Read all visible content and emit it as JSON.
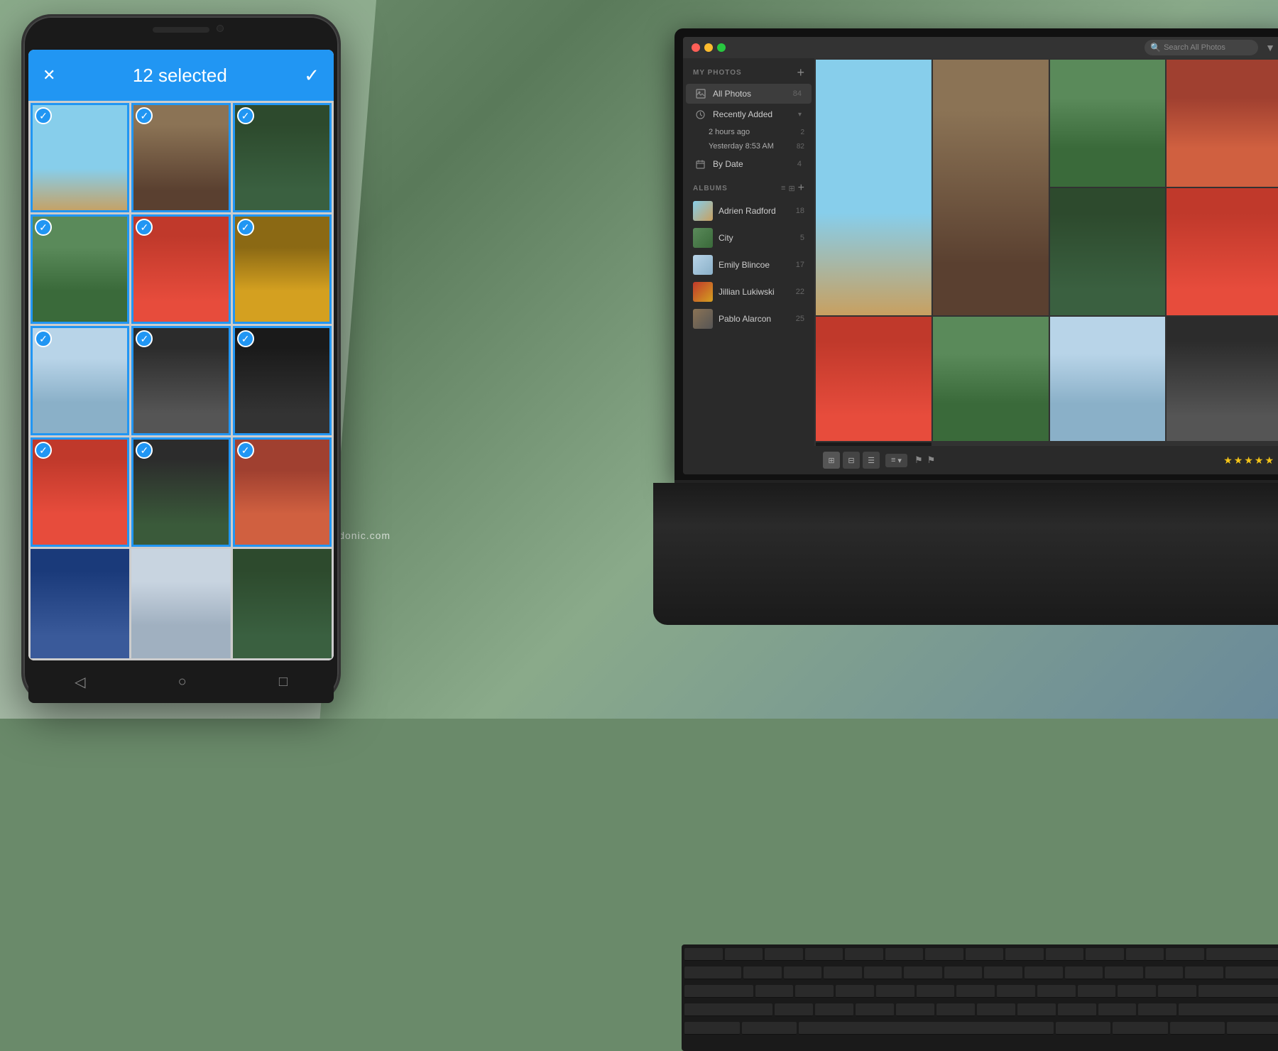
{
  "background": {
    "color": "#6a8a6a"
  },
  "phone": {
    "topbar": {
      "close_label": "✕",
      "selected_text": "12 selected",
      "check_label": "✓"
    },
    "photos": [
      {
        "id": 1,
        "selected": true,
        "scene": "scene-jump"
      },
      {
        "id": 2,
        "selected": true,
        "scene": "scene-tv"
      },
      {
        "id": 3,
        "selected": true,
        "scene": "scene-food"
      },
      {
        "id": 4,
        "selected": true,
        "scene": "scene-field"
      },
      {
        "id": 5,
        "selected": true,
        "scene": "scene-red"
      },
      {
        "id": 6,
        "selected": true,
        "scene": "scene-diner"
      },
      {
        "id": 7,
        "selected": true,
        "scene": "scene-cloud"
      },
      {
        "id": 8,
        "selected": true,
        "scene": "scene-portrait"
      },
      {
        "id": 9,
        "selected": true,
        "scene": "scene-dark"
      },
      {
        "id": 10,
        "selected": true,
        "scene": "scene-door"
      },
      {
        "id": 11,
        "selected": true,
        "scene": "scene-trees"
      },
      {
        "id": 12,
        "selected": true,
        "scene": "scene-autumn"
      },
      {
        "id": 13,
        "selected": false,
        "scene": "scene-graffiti"
      },
      {
        "id": 14,
        "selected": false,
        "scene": "scene-window"
      },
      {
        "id": 15,
        "selected": false,
        "scene": "scene-forest"
      }
    ],
    "navbar": {
      "back_icon": "◁",
      "home_icon": "○",
      "recent_icon": "□"
    }
  },
  "laptop": {
    "titlebar": {
      "buttons": {
        "red": "●",
        "yellow": "●",
        "green": "●"
      },
      "search_placeholder": "Search All Photos",
      "filter_icon": "▼"
    },
    "sidebar": {
      "my_photos_label": "MY PHOTOS",
      "add_btn": "+",
      "items": [
        {
          "id": "all-photos",
          "icon": "📷",
          "label": "All Photos",
          "count": "84",
          "active": true
        },
        {
          "id": "recently-added",
          "icon": "🕐",
          "label": "Recently Added",
          "count": "",
          "expandable": true,
          "subitems": [
            {
              "label": "2 hours ago",
              "count": "2"
            },
            {
              "label": "Yesterday 8:53 AM",
              "count": "82"
            }
          ]
        },
        {
          "id": "by-date",
          "icon": "📅",
          "label": "By Date",
          "count": "4"
        }
      ],
      "albums_label": "ALBUMS",
      "albums": [
        {
          "id": "adrien-radford",
          "label": "Adrien Radford",
          "count": "18",
          "theme": "at1"
        },
        {
          "id": "city",
          "label": "City",
          "count": "5",
          "theme": "at2"
        },
        {
          "id": "emily-blincoe",
          "label": "Emily Blincoe",
          "count": "17",
          "theme": "at3"
        },
        {
          "id": "jillian-lukiwski",
          "label": "Jillian Lukiwski",
          "count": "22",
          "theme": "at4"
        },
        {
          "id": "pablo-alarcon",
          "label": "Pablo Alarcon",
          "count": "25",
          "theme": "at5"
        }
      ]
    },
    "main": {
      "photos": [
        {
          "id": 1,
          "theme": "mp1",
          "tall": true
        },
        {
          "id": 2,
          "theme": "mp2",
          "tall": true
        },
        {
          "id": 3,
          "theme": "mp3",
          "tall": false
        },
        {
          "id": 4,
          "theme": "mp4",
          "tall": false
        },
        {
          "id": 5,
          "theme": "mp5",
          "tall": false
        },
        {
          "id": 6,
          "theme": "mp6",
          "tall": false
        },
        {
          "id": 7,
          "theme": "mp7",
          "tall": false
        },
        {
          "id": 8,
          "theme": "mp8",
          "tall": false
        },
        {
          "id": 9,
          "theme": "mp9",
          "tall": false
        },
        {
          "id": 10,
          "theme": "mp10",
          "tall": false
        },
        {
          "id": 11,
          "theme": "mp11",
          "tall": false
        }
      ],
      "bottom_bar": {
        "view_icons": [
          "⊞",
          "⊟",
          "☰"
        ],
        "sort_label": "≡ ▼",
        "filter_icons": [
          "⚑",
          "⚑"
        ],
        "rating_stars": "★★★★★"
      }
    }
  },
  "watermark": {
    "text": "crackedonic.com"
  }
}
